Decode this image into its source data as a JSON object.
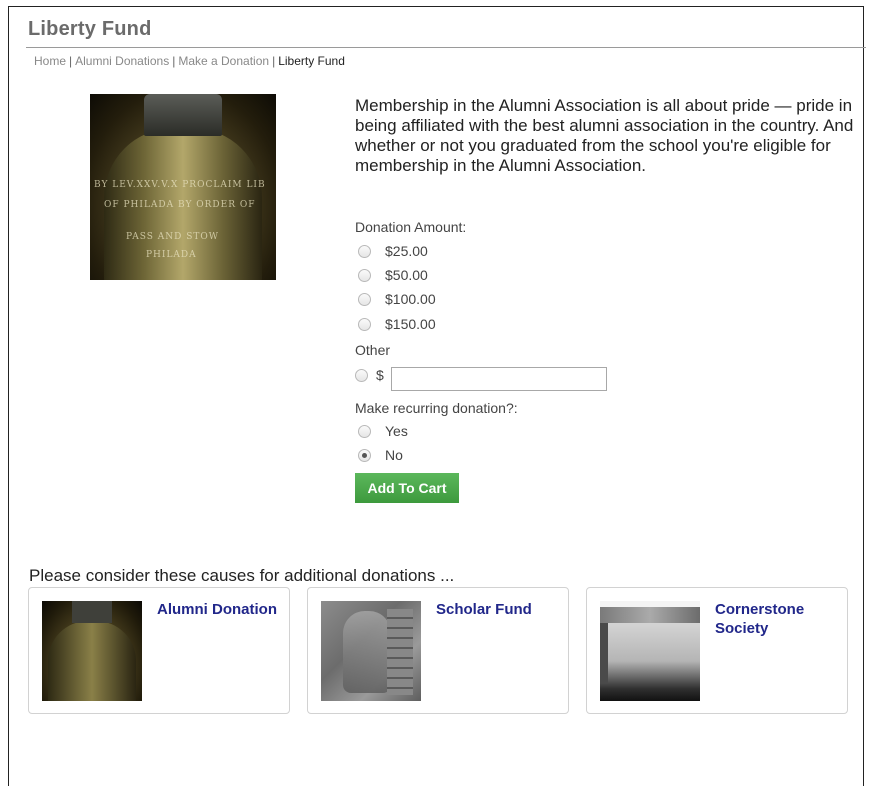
{
  "page": {
    "title": "Liberty Fund"
  },
  "breadcrumb": [
    {
      "label": "Home"
    },
    {
      "label": "Alumni Donations"
    },
    {
      "label": "Make a Donation"
    },
    {
      "label": "Liberty Fund"
    }
  ],
  "hero": {
    "engraving": [
      "BY LEV.XXV.V.X PROCLAIM LIB",
      "OF PHILADA BY ORDER OF",
      "PASS AND STOW",
      "PHILADA"
    ]
  },
  "intro_text": "Membership in the Alumni Association is all about pride — pride in being affiliated with the best alumni association in the country. And whether or not you graduated from the school you're eligible for membership in the Alumni Association.",
  "donation": {
    "label": "Donation Amount:",
    "options": [
      "$25.00",
      "$50.00",
      "$100.00",
      "$150.00"
    ],
    "other_label": "Other",
    "currency_symbol": "$",
    "other_value": ""
  },
  "recurring": {
    "label": "Make recurring donation?:",
    "options": [
      "Yes",
      "No"
    ],
    "selected": "No"
  },
  "add_to_cart_label": "Add To Cart",
  "causes": {
    "heading": "Please consider these causes for additional donations ...",
    "items": [
      {
        "name": "Alumni Donation",
        "icon": "liberty-bell-thumbnail"
      },
      {
        "name": "Scholar Fund",
        "icon": "stone-relief-thumbnail"
      },
      {
        "name": "Cornerstone Society",
        "icon": "cornerstone-thumbnail"
      }
    ]
  },
  "colors": {
    "button_green": "#4cae4c",
    "link_blue": "#21278a",
    "title_gray": "#6b6b6b"
  }
}
